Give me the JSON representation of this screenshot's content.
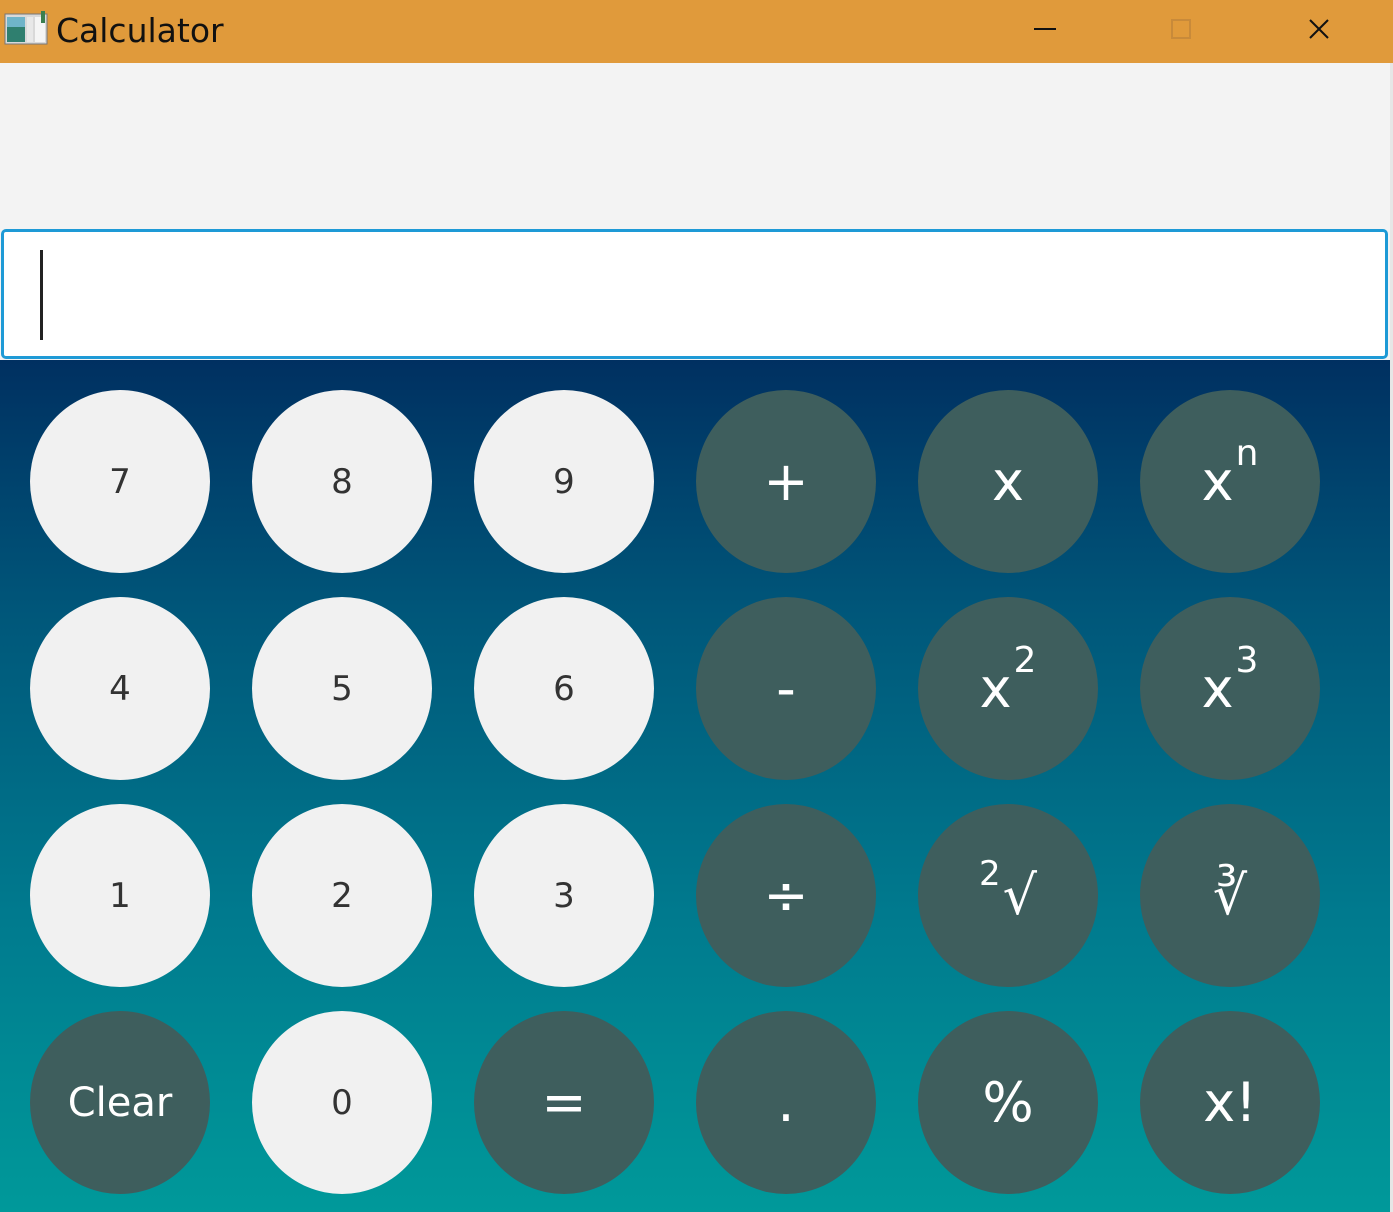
{
  "window": {
    "title": "Calculator",
    "controls": {
      "minimize": "minimize",
      "maximize": "maximize",
      "close": "close"
    },
    "accent_color": "#e09a3b"
  },
  "display": {
    "value": "",
    "focus_color": "#1e9ad6"
  },
  "keypad": {
    "rows": [
      [
        {
          "label": "7",
          "style": "light"
        },
        {
          "label": "8",
          "style": "light"
        },
        {
          "label": "9",
          "style": "light"
        },
        {
          "label": "+",
          "style": "dark"
        },
        {
          "label": "x",
          "style": "dark"
        },
        {
          "label": "x",
          "sup": "n",
          "style": "dark"
        }
      ],
      [
        {
          "label": "4",
          "style": "light"
        },
        {
          "label": "5",
          "style": "light"
        },
        {
          "label": "6",
          "style": "light"
        },
        {
          "label": "-",
          "style": "dark"
        },
        {
          "label": "x",
          "sup": "2",
          "style": "dark"
        },
        {
          "label": "x",
          "sup": "3",
          "style": "dark"
        }
      ],
      [
        {
          "label": "1",
          "style": "light"
        },
        {
          "label": "2",
          "style": "light"
        },
        {
          "label": "3",
          "style": "light"
        },
        {
          "label": "÷",
          "style": "dark"
        },
        {
          "label": "√",
          "pre": "2",
          "style": "dark"
        },
        {
          "label": "∛",
          "style": "dark"
        }
      ],
      [
        {
          "label": "Clear",
          "style": "dark"
        },
        {
          "label": "0",
          "style": "light"
        },
        {
          "label": "=",
          "style": "dark"
        },
        {
          "label": ".",
          "style": "dark"
        },
        {
          "label": "%",
          "style": "dark"
        },
        {
          "label": "x!",
          "style": "dark"
        }
      ]
    ],
    "colors": {
      "light_key": "#f1f1f1",
      "dark_key": "#3e5e5d",
      "gradient_top": "#003061",
      "gradient_bottom": "#00999a"
    }
  }
}
